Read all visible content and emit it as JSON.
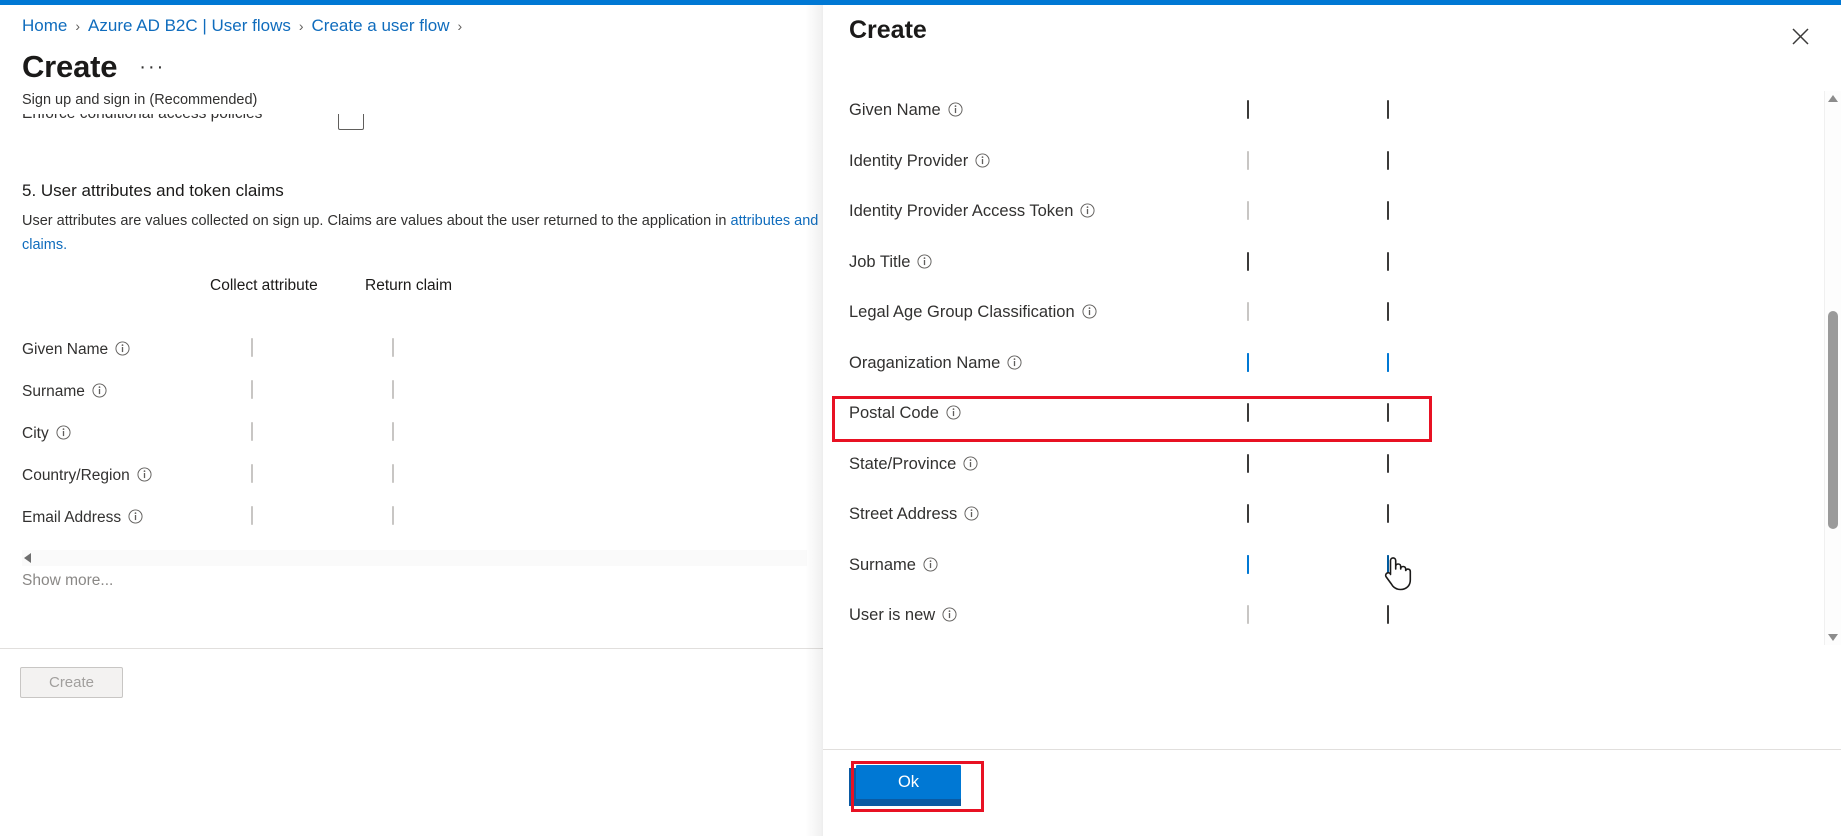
{
  "colors": {
    "accent": "#0078d4",
    "accent_hover": "#005a9e",
    "link": "#0f6cbd",
    "annotation_red": "#e81123",
    "title_text": "#1b1a19"
  },
  "breadcrumb": {
    "items": [
      {
        "label": "Home"
      },
      {
        "label": "Azure AD B2C | User flows"
      },
      {
        "label": "Create a user flow"
      }
    ],
    "separator": "›"
  },
  "header": {
    "title": "Create",
    "ellipsis": "···",
    "subtitle": "Sign up and sign in (Recommended)"
  },
  "cut_row": {
    "label": "Enforce conditional access policies"
  },
  "section": {
    "number_title": "5. User attributes and token claims",
    "description": "User attributes are values collected on sign up. Claims are values about the user returned to the application in",
    "link_text": "attributes and claims."
  },
  "table": {
    "headers": {
      "collect": "Collect attribute",
      "return": "Return claim"
    },
    "rows": [
      {
        "label": "Given Name",
        "info": "info-icon",
        "collect": "unchecked-disabled",
        "return": "unchecked-disabled"
      },
      {
        "label": "Surname",
        "info": "info-icon",
        "collect": "unchecked-disabled",
        "return": "unchecked-disabled"
      },
      {
        "label": "City",
        "info": "info-icon",
        "collect": "unchecked-disabled",
        "return": "unchecked-disabled"
      },
      {
        "label": "Country/Region",
        "info": "info-icon",
        "collect": "unchecked-disabled",
        "return": "unchecked-disabled"
      },
      {
        "label": "Email Address",
        "info": "info-icon",
        "collect": "unchecked-disabled",
        "return": "unchecked-disabled"
      }
    ],
    "show_more": "Show more..."
  },
  "footer": {
    "create_label": "Create",
    "create_disabled": true
  },
  "panel": {
    "title": "Create",
    "close_icon": "close-icon",
    "ok_label": "Ok",
    "rows": [
      {
        "label": "Given Name",
        "info": "info-icon",
        "collect": "unchecked-enabled",
        "return": "unchecked-enabled"
      },
      {
        "label": "Identity Provider",
        "info": "info-icon",
        "collect": "unchecked-disabled",
        "return": "unchecked-enabled"
      },
      {
        "label": "Identity Provider Access Token",
        "info": "info-icon",
        "collect": "unchecked-disabled",
        "return": "unchecked-enabled"
      },
      {
        "label": "Job Title",
        "info": "info-icon",
        "collect": "unchecked-enabled",
        "return": "unchecked-enabled"
      },
      {
        "label": "Legal Age Group Classification",
        "info": "info-icon",
        "collect": "unchecked-disabled",
        "return": "unchecked-enabled"
      },
      {
        "label": "Oraganization Name",
        "info": "info-icon",
        "collect": "checked",
        "return": "checked"
      },
      {
        "label": "Postal Code",
        "info": "info-icon",
        "collect": "unchecked-enabled",
        "return": "unchecked-enabled"
      },
      {
        "label": "State/Province",
        "info": "info-icon",
        "collect": "unchecked-enabled",
        "return": "unchecked-enabled"
      },
      {
        "label": "Street Address",
        "info": "info-icon",
        "collect": "unchecked-enabled",
        "return": "unchecked-enabled"
      },
      {
        "label": "Surname",
        "info": "info-icon",
        "collect": "checked",
        "return": "checked-hover"
      },
      {
        "label": "User is new",
        "info": "info-icon",
        "collect": "unchecked-disabled",
        "return": "unchecked-enabled"
      }
    ]
  },
  "annotations": [
    {
      "name": "organization-name-row-highlight",
      "target": "Oraganization Name"
    },
    {
      "name": "ok-button-highlight",
      "target": "Ok"
    }
  ]
}
